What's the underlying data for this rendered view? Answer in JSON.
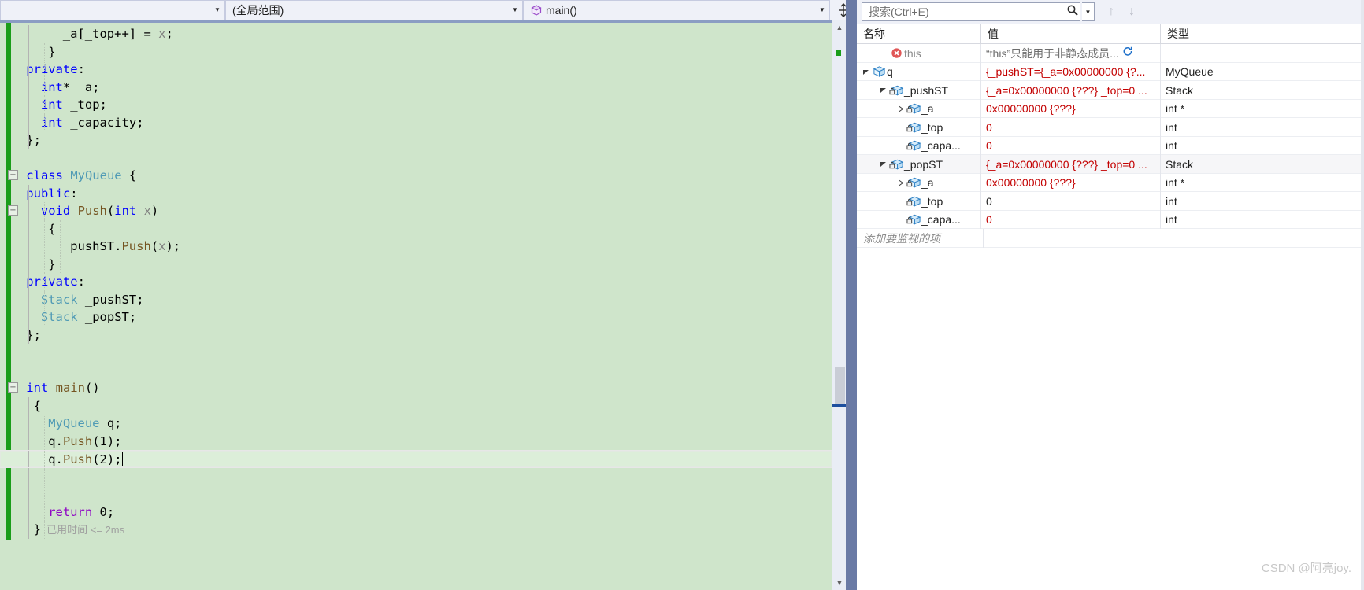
{
  "editor_nav": {
    "scope_combo": "(全局范围)",
    "member_combo": "main()",
    "project_combo": "",
    "split_icon": "split-window-icon",
    "dropdown_icon": "chevron-down-icon"
  },
  "code": {
    "lines": [
      {
        "indent": 6,
        "parts": [
          {
            "t": "_a[_top++] = ",
            "c": "ident"
          },
          {
            "t": "x",
            "c": "par"
          },
          {
            "t": ";",
            "c": "op"
          }
        ]
      },
      {
        "indent": 4,
        "parts": [
          {
            "t": "}",
            "c": "op"
          }
        ]
      },
      {
        "indent": 1,
        "parts": [
          {
            "t": "private",
            "c": "kw"
          },
          {
            "t": ":",
            "c": "op"
          }
        ]
      },
      {
        "indent": 3,
        "parts": [
          {
            "t": "int",
            "c": "kw"
          },
          {
            "t": "* _a;",
            "c": "ident"
          }
        ]
      },
      {
        "indent": 3,
        "parts": [
          {
            "t": "int",
            "c": "kw"
          },
          {
            "t": " _top;",
            "c": "ident"
          }
        ]
      },
      {
        "indent": 3,
        "parts": [
          {
            "t": "int",
            "c": "kw"
          },
          {
            "t": " _capacity;",
            "c": "ident"
          }
        ]
      },
      {
        "indent": 1,
        "parts": [
          {
            "t": "};",
            "c": "op"
          }
        ]
      },
      {
        "indent": 0,
        "parts": []
      },
      {
        "indent": 1,
        "parts": [
          {
            "t": "class",
            "c": "kw"
          },
          {
            "t": " ",
            "c": "op"
          },
          {
            "t": "MyQueue",
            "c": "typ"
          },
          {
            "t": " {",
            "c": "op"
          }
        ]
      },
      {
        "indent": 1,
        "parts": [
          {
            "t": "public",
            "c": "kw"
          },
          {
            "t": ":",
            "c": "op"
          }
        ]
      },
      {
        "indent": 3,
        "parts": [
          {
            "t": "void",
            "c": "kw"
          },
          {
            "t": " ",
            "c": "op"
          },
          {
            "t": "Push",
            "c": "fn"
          },
          {
            "t": "(",
            "c": "op"
          },
          {
            "t": "int",
            "c": "kw"
          },
          {
            "t": " ",
            "c": "op"
          },
          {
            "t": "x",
            "c": "par"
          },
          {
            "t": ")",
            "c": "op"
          }
        ]
      },
      {
        "indent": 4,
        "parts": [
          {
            "t": "{",
            "c": "op"
          }
        ]
      },
      {
        "indent": 6,
        "parts": [
          {
            "t": "_pushST.",
            "c": "ident"
          },
          {
            "t": "Push",
            "c": "fn"
          },
          {
            "t": "(",
            "c": "op"
          },
          {
            "t": "x",
            "c": "par"
          },
          {
            "t": ");",
            "c": "op"
          }
        ]
      },
      {
        "indent": 4,
        "parts": [
          {
            "t": "}",
            "c": "op"
          }
        ]
      },
      {
        "indent": 1,
        "parts": [
          {
            "t": "private",
            "c": "kw"
          },
          {
            "t": ":",
            "c": "op"
          }
        ]
      },
      {
        "indent": 3,
        "parts": [
          {
            "t": "Stack",
            "c": "typ"
          },
          {
            "t": " _pushST;",
            "c": "ident"
          }
        ]
      },
      {
        "indent": 3,
        "parts": [
          {
            "t": "Stack",
            "c": "typ"
          },
          {
            "t": " _popST;",
            "c": "ident"
          }
        ]
      },
      {
        "indent": 1,
        "parts": [
          {
            "t": "};",
            "c": "op"
          }
        ]
      },
      {
        "indent": 0,
        "parts": []
      },
      {
        "indent": 0,
        "parts": []
      },
      {
        "indent": 1,
        "parts": [
          {
            "t": "int",
            "c": "kw"
          },
          {
            "t": " ",
            "c": "op"
          },
          {
            "t": "main",
            "c": "fn"
          },
          {
            "t": "()",
            "c": "op"
          }
        ]
      },
      {
        "indent": 2,
        "parts": [
          {
            "t": "{",
            "c": "op"
          }
        ]
      },
      {
        "indent": 4,
        "parts": [
          {
            "t": "MyQueue",
            "c": "typ"
          },
          {
            "t": " q;",
            "c": "ident"
          }
        ]
      },
      {
        "indent": 4,
        "parts": [
          {
            "t": "q.",
            "c": "ident"
          },
          {
            "t": "Push",
            "c": "fn"
          },
          {
            "t": "(",
            "c": "op"
          },
          {
            "t": "1",
            "c": "num"
          },
          {
            "t": ");",
            "c": "op"
          }
        ]
      },
      {
        "indent": 4,
        "parts": [
          {
            "t": "q.",
            "c": "ident"
          },
          {
            "t": "Push",
            "c": "fn"
          },
          {
            "t": "(",
            "c": "op"
          },
          {
            "t": "2",
            "c": "num"
          },
          {
            "t": ");",
            "c": "op"
          }
        ],
        "current": true
      },
      {
        "indent": 0,
        "parts": []
      },
      {
        "indent": 0,
        "parts": []
      },
      {
        "indent": 4,
        "parts": [
          {
            "t": "return",
            "c": "ctl"
          },
          {
            "t": " ",
            "c": "op"
          },
          {
            "t": "0",
            "c": "num"
          },
          {
            "t": ";",
            "c": "op"
          }
        ]
      },
      {
        "indent": 2,
        "parts": [
          {
            "t": "}",
            "c": "op"
          }
        ],
        "elapsed": "已用时间 <= 2ms"
      }
    ]
  },
  "watch_panel": {
    "search": {
      "placeholder": "搜索(Ctrl+E)",
      "value": "",
      "icon": "search-icon"
    },
    "toolbar_icons": {
      "up": "arrow-up-icon",
      "down": "arrow-down-icon",
      "dropdown": "chevron-down-icon"
    },
    "columns": {
      "name": "名称",
      "value": "值",
      "type": "类型"
    },
    "rows": [
      {
        "depth": 1,
        "expander": "none",
        "icon": "error-icon",
        "name": "this",
        "value": "“this”只能用于非静态成员...",
        "value_color": "grey",
        "type": "",
        "refresh": "refresh-icon"
      },
      {
        "depth": 0,
        "expander": "expanded",
        "icon": "object-icon",
        "name": "q",
        "value": "{_pushST={_a=0x00000000 {?...",
        "value_color": "red",
        "type": "MyQueue"
      },
      {
        "depth": 1,
        "expander": "expanded",
        "icon": "field-icon",
        "name": "_pushST",
        "value": "{_a=0x00000000 {???} _top=0 ...",
        "value_color": "red",
        "type": "Stack"
      },
      {
        "depth": 2,
        "expander": "collapsed",
        "icon": "field-icon",
        "name": "_a",
        "value": "0x00000000 {???}",
        "value_color": "red",
        "type": "int *"
      },
      {
        "depth": 2,
        "expander": "none",
        "icon": "field-icon",
        "name": "_top",
        "value": "0",
        "value_color": "red",
        "type": "int"
      },
      {
        "depth": 2,
        "expander": "none",
        "icon": "field-icon",
        "name": "_capa...",
        "value": "0",
        "value_color": "red",
        "type": "int"
      },
      {
        "depth": 1,
        "expander": "expanded",
        "icon": "field-icon",
        "name": "_popST",
        "value": "{_a=0x00000000 {???} _top=0 ...",
        "value_color": "red",
        "type": "Stack"
      },
      {
        "depth": 2,
        "expander": "collapsed",
        "icon": "field-icon",
        "name": "_a",
        "value": "0x00000000 {???}",
        "value_color": "red",
        "type": "int *"
      },
      {
        "depth": 2,
        "expander": "none",
        "icon": "field-icon",
        "name": "_top",
        "value": "0",
        "value_color": "black",
        "type": "int"
      },
      {
        "depth": 2,
        "expander": "none",
        "icon": "field-icon",
        "name": "_capa...",
        "value": "0",
        "value_color": "red",
        "type": "int"
      }
    ],
    "add_watch_placeholder": "添加要监视的项"
  },
  "watermark": "CSDN @阿亮joy."
}
